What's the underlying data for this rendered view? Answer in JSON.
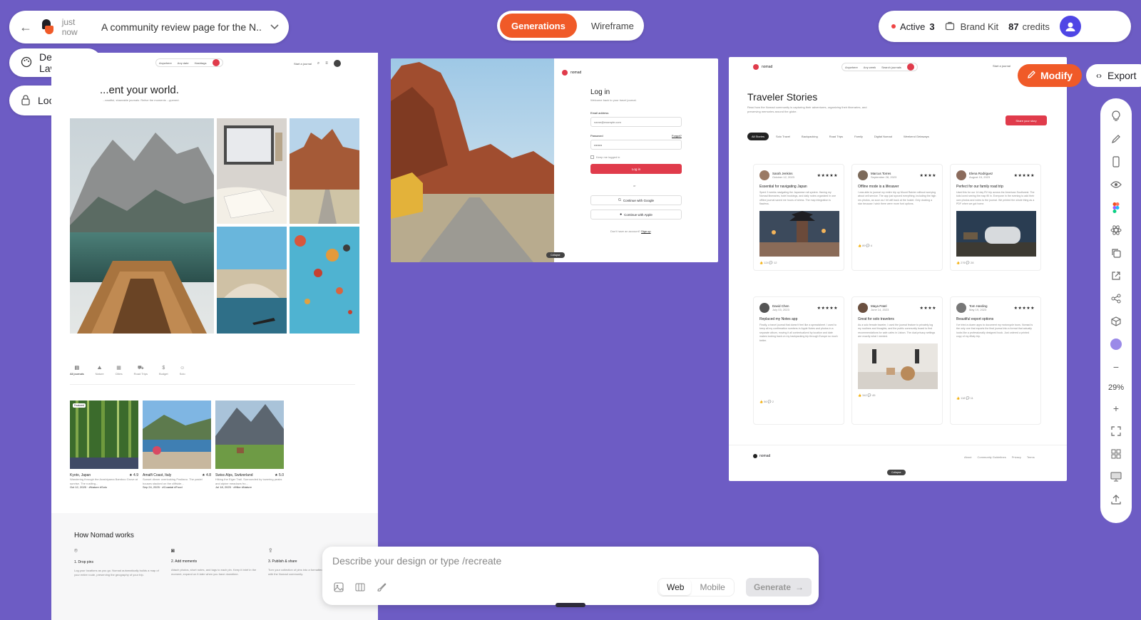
{
  "colors": {
    "canvas": "#6d5cc4",
    "accent": "#f05a28",
    "brand_red": "#e03b4b"
  },
  "project": {
    "time": "just now",
    "title": "A community review page for the N..."
  },
  "left_pills": {
    "design_law": "Design Law",
    "locked_rules": "Locked Rules"
  },
  "mode_tabs": [
    {
      "label": "Generations",
      "active": true
    },
    {
      "label": "Wireframe",
      "active": false
    }
  ],
  "top_right": {
    "active_label": "Active",
    "active_count": "3",
    "brand_kit": "Brand Kit",
    "credits_value": "87",
    "credits_label": "credits"
  },
  "frame_journal": {
    "nav": {
      "anywhere": "Anywhere",
      "any_date": "Any date",
      "hashtags": "Hashtags",
      "cta": "Start a journal"
    },
    "heading": "...ent your world.",
    "sub": "...eautiful, shareable journals. Relive the moments ...ppened.",
    "categories": [
      "All journals",
      "Nature",
      "Cities",
      "Road Trips",
      "Budget",
      "Solo"
    ],
    "cards": [
      {
        "place": "Kyoto, Japan",
        "rating": "4.9",
        "desc": "Wandering through the Arashiyama Bamboo Grove at sunrise. The rustling...",
        "meta": "Oct 12, 2025 · #Nature #Solo",
        "badge": "Featured"
      },
      {
        "place": "Amalfi Coast, Italy",
        "rating": "4.8",
        "desc": "Sunset dinner overlooking Positano. The pastel houses stacked on the cliffside...",
        "meta": "Sep 24, 2025 · #Coastal #Food"
      },
      {
        "place": "Swiss Alps, Switzerland",
        "rating": "5.0",
        "desc": "Hiking the Eiger Trail. Surrounded by towering peaks and alpine meadows fro...",
        "meta": "Jul 18, 2025 · #Hike #Nature"
      }
    ],
    "how": {
      "title": "How Nomad works",
      "steps": [
        {
          "title": "1. Drop pins",
          "desc": "Log your locations as you go. Nomad automatically builds a map of your entire route, preserving the geography of your trip."
        },
        {
          "title": "2. Add moments",
          "desc": "Attach photos, short notes, and tags to each pin. Keep it brief in the moment, expand on it later when you have downtime."
        },
        {
          "title": "3. Publish & share",
          "desc": "Turn your collection of pins into a formatted journal entry. Share it with the Nomad community."
        }
      ]
    }
  },
  "frame_login": {
    "brand": "nomad",
    "title": "Log in",
    "sub": "Welcome back to your travel journal.",
    "email_label": "Email address",
    "email_placeholder": "name@example.com",
    "password_label": "Password",
    "forgot": "Forgot?",
    "password_value": "••••••••",
    "remember": "Keep me logged in",
    "login_btn": "Log in",
    "or": "or",
    "google": "Continue with Google",
    "apple": "Continue with Apple",
    "no_account": "Don't have an account?",
    "signup": "Sign up",
    "collapse": "Collapse"
  },
  "frame_stories": {
    "brand": "nomad",
    "nav": {
      "anywhere": "Anywhere",
      "any_week": "Any week",
      "search": "Search journals",
      "cta": "Start a journal"
    },
    "title": "Traveler Stories",
    "sub": "Read how the Nomad community is capturing their adventures, organizing their itineraries, and preserving memories around the globe.",
    "share_btn": "Share your story",
    "filters": [
      "All Stories",
      "Solo Travel",
      "Backpacking",
      "Road Trips",
      "Family",
      "Digital Nomad",
      "Weekend Getaways"
    ],
    "stories": [
      {
        "name": "Sarah Jenkins",
        "date": "October 12, 2023",
        "stars": "★★★★★",
        "title": "Essential for navigating Japan",
        "body": "Spent 3 weeks navigating the Japanese rail system. Having my Nomad itineraries, hotel bookings, and daily notes organized in one offline journal saved me hours of stress. The map integration is flawless.",
        "likes": "124",
        "comments": "12"
      },
      {
        "name": "Marcus Torres",
        "date": "September 28, 2023",
        "stars": "★★★★",
        "title": "Offline mode is a lifesaver",
        "body": "I was able to journal my entire trip up Mount Rainier without worrying about cell service. The app just synced everything, including the high res photos, as soon as I hit wifi back at the hostel. Only docking a star because I wish there were more font options.",
        "likes": "89",
        "comments": "4"
      },
      {
        "name": "Elena Rodriguez",
        "date": "August 15, 2023",
        "stars": "★★★★★",
        "title": "Perfect for our family road trip",
        "body": "Used this for our 14 day RV trip across the American Southwest. The kids loved seeing the map fill in. Everyone in the evening to add their own photos and notes to the journal. We printed the whole thing as a PDF when we got home.",
        "likes": "276",
        "comments": "28"
      },
      {
        "name": "David Chen",
        "date": "July 03, 2023",
        "stars": "★★★★★",
        "title": "Replaced my Notes app",
        "body": "Finally, a travel journal that doesn't feel like a spreadsheet. I used to keep all my confirmation numbers in Apple Notes and photos in a separate album, moving it all contextualized by location and date makes looking back on my backpacking trip through Europe so much better.",
        "likes": "56",
        "comments": "2"
      },
      {
        "name": "Maya Patel",
        "date": "June 14, 2023",
        "stars": "★★★★",
        "title": "Great for solo travelers",
        "body": "As a solo female traveler, I used the journal feature to privately log my routines and thoughts, and the public community board to find recommendations for safe cafes in Lisbon. The dual privacy settings are exactly what I needed.",
        "likes": "342",
        "comments": "45"
      },
      {
        "name": "Tom Harding",
        "date": "May 19, 2023",
        "stars": "★★★★★",
        "title": "Beautiful export options",
        "body": "I've tried a dozen apps to document my motorcycle tours. Nomad is the only one that exports the final journal into a format that actually looks like a professionally designed book. Just ordered a printed copy of my #Italy trip.",
        "likes": "118",
        "comments": "11"
      }
    ],
    "footer": {
      "brand": "nomad",
      "links": [
        "About",
        "Community Guidelines",
        "Privacy",
        "Terms"
      ]
    },
    "collapse": "Collapse"
  },
  "actions": {
    "modify": "Modify",
    "export": "Export"
  },
  "toolbar": {
    "zoom": "29%"
  },
  "prompt": {
    "placeholder": "Describe your design or type /recreate",
    "platforms": [
      {
        "label": "Web",
        "active": true
      },
      {
        "label": "Mobile",
        "active": false
      }
    ],
    "generate": "Generate"
  }
}
